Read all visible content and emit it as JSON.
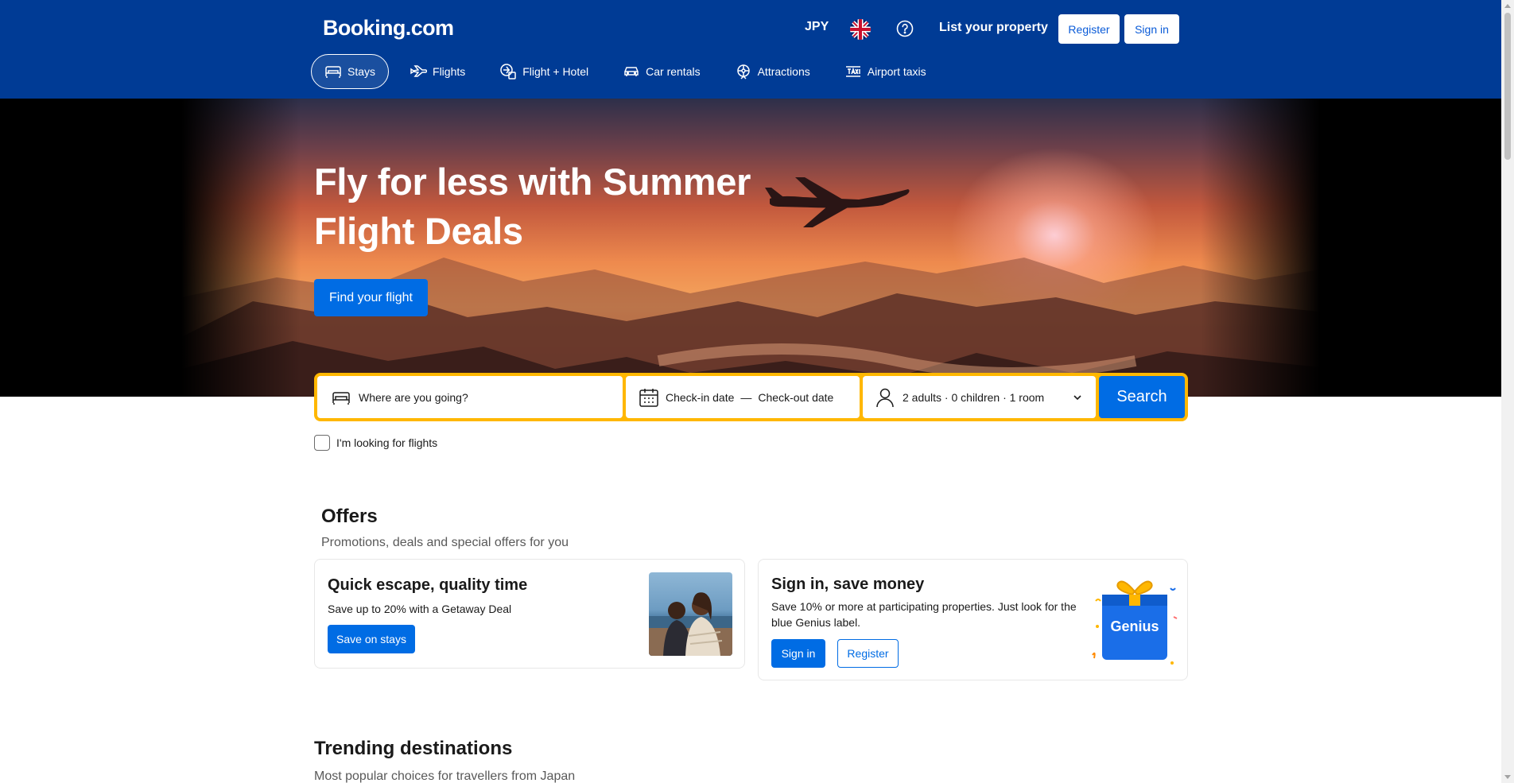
{
  "header": {
    "logo": "Booking.com",
    "currency": "JPY",
    "language_icon": "uk-flag-icon",
    "help_icon": "question-circle-icon",
    "list_property": "List your property",
    "register": "Register",
    "sign_in": "Sign in"
  },
  "nav": {
    "items": [
      {
        "label": "Stays",
        "icon": "bed-icon",
        "active": true
      },
      {
        "label": "Flights",
        "icon": "plane-icon"
      },
      {
        "label": "Flight + Hotel",
        "icon": "flight-hotel-icon"
      },
      {
        "label": "Car rentals",
        "icon": "car-icon"
      },
      {
        "label": "Attractions",
        "icon": "attractions-icon"
      },
      {
        "label": "Airport taxis",
        "icon": "taxi-icon"
      }
    ]
  },
  "hero": {
    "title": "Fly for less with Summer Flight Deals",
    "cta": "Find your flight"
  },
  "search": {
    "destination": "Where are you going?",
    "check_in": "Check-in date",
    "dash": "—",
    "check_out": "Check-out date",
    "guests": "2 adults · 0 children · 1 room",
    "button": "Search",
    "flights_checkbox": "I'm looking for flights"
  },
  "offers": {
    "title": "Offers",
    "subtitle": "Promotions, deals and special offers for you",
    "cards": [
      {
        "title": "Quick escape, quality time",
        "text": "Save up to 20% with a Getaway Deal",
        "button": "Save on stays"
      },
      {
        "title": "Sign in, save money",
        "text": "Save 10% or more at participating properties. Just look for the blue Genius label.",
        "button_primary": "Sign in",
        "button_secondary": "Register",
        "badge": "Genius"
      }
    ]
  },
  "trending": {
    "title": "Trending destinations",
    "subtitle": "Most popular choices for travellers from Japan"
  },
  "colors": {
    "brand_blue": "#003b95",
    "action_blue": "#006ce4",
    "search_yellow": "#ffb700"
  }
}
